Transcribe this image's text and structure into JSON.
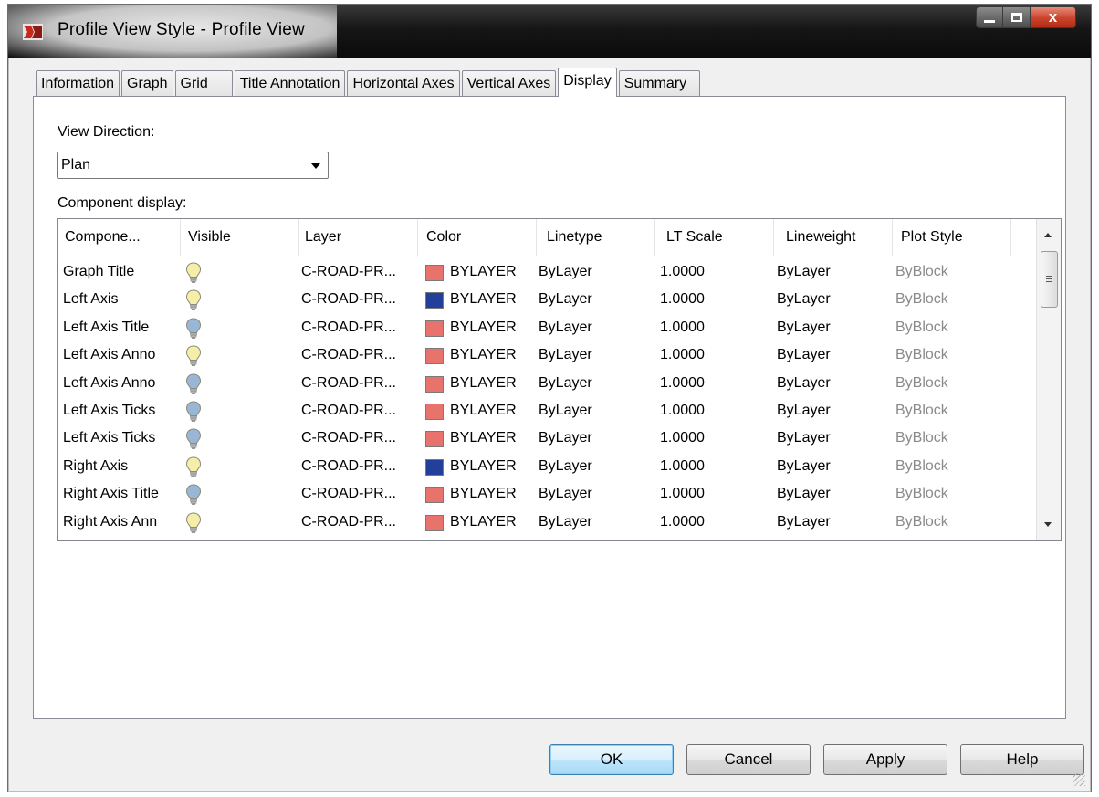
{
  "window": {
    "title": "Profile View Style - Profile View",
    "close_glyph": "x"
  },
  "tabs": [
    {
      "label": "Information",
      "active": false
    },
    {
      "label": "Graph",
      "active": false
    },
    {
      "label": "Grid",
      "active": false
    },
    {
      "label": "Title Annotation",
      "active": false
    },
    {
      "label": "Horizontal Axes",
      "active": false
    },
    {
      "label": "Vertical Axes",
      "active": false
    },
    {
      "label": "Display",
      "active": true
    },
    {
      "label": "Summary",
      "active": false
    }
  ],
  "display": {
    "view_direction_label": "View Direction:",
    "view_direction_value": "Plan",
    "component_display_label": "Component display:",
    "columns": [
      "Compone...",
      "Visible",
      "Layer",
      "Color",
      "Linetype",
      "LT Scale",
      "Lineweight",
      "Plot Style"
    ],
    "rows": [
      {
        "component": "Graph Title",
        "visible": "off",
        "layer": "C-ROAD-PR...",
        "color_swatch": "#e8736c",
        "color": "BYLAYER",
        "linetype": "ByLayer",
        "lt_scale": "1.0000",
        "lineweight": "ByLayer",
        "plot_style": "ByBlock"
      },
      {
        "component": "Left Axis",
        "visible": "off",
        "layer": "C-ROAD-PR...",
        "color_swatch": "#22409a",
        "color": "BYLAYER",
        "linetype": "ByLayer",
        "lt_scale": "1.0000",
        "lineweight": "ByLayer",
        "plot_style": "ByBlock"
      },
      {
        "component": "Left Axis Title",
        "visible": "on",
        "layer": "C-ROAD-PR...",
        "color_swatch": "#e8736c",
        "color": "BYLAYER",
        "linetype": "ByLayer",
        "lt_scale": "1.0000",
        "lineweight": "ByLayer",
        "plot_style": "ByBlock"
      },
      {
        "component": "Left Axis Anno",
        "visible": "off",
        "layer": "C-ROAD-PR...",
        "color_swatch": "#e8736c",
        "color": "BYLAYER",
        "linetype": "ByLayer",
        "lt_scale": "1.0000",
        "lineweight": "ByLayer",
        "plot_style": "ByBlock"
      },
      {
        "component": "Left Axis Anno",
        "visible": "on",
        "layer": "C-ROAD-PR...",
        "color_swatch": "#e8736c",
        "color": "BYLAYER",
        "linetype": "ByLayer",
        "lt_scale": "1.0000",
        "lineweight": "ByLayer",
        "plot_style": "ByBlock"
      },
      {
        "component": "Left Axis Ticks",
        "visible": "on",
        "layer": "C-ROAD-PR...",
        "color_swatch": "#e8736c",
        "color": "BYLAYER",
        "linetype": "ByLayer",
        "lt_scale": "1.0000",
        "lineweight": "ByLayer",
        "plot_style": "ByBlock"
      },
      {
        "component": "Left Axis Ticks",
        "visible": "on",
        "layer": "C-ROAD-PR...",
        "color_swatch": "#e8736c",
        "color": "BYLAYER",
        "linetype": "ByLayer",
        "lt_scale": "1.0000",
        "lineweight": "ByLayer",
        "plot_style": "ByBlock"
      },
      {
        "component": "Right Axis",
        "visible": "off",
        "layer": "C-ROAD-PR...",
        "color_swatch": "#22409a",
        "color": "BYLAYER",
        "linetype": "ByLayer",
        "lt_scale": "1.0000",
        "lineweight": "ByLayer",
        "plot_style": "ByBlock"
      },
      {
        "component": "Right Axis Title",
        "visible": "on",
        "layer": "C-ROAD-PR...",
        "color_swatch": "#e8736c",
        "color": "BYLAYER",
        "linetype": "ByLayer",
        "lt_scale": "1.0000",
        "lineweight": "ByLayer",
        "plot_style": "ByBlock"
      },
      {
        "component": "Right Axis Ann",
        "visible": "off",
        "layer": "C-ROAD-PR...",
        "color_swatch": "#e8736c",
        "color": "BYLAYER",
        "linetype": "ByLayer",
        "lt_scale": "1.0000",
        "lineweight": "ByLayer",
        "plot_style": "ByBlock"
      }
    ]
  },
  "buttons": {
    "ok": "OK",
    "cancel": "Cancel",
    "apply": "Apply",
    "help": "Help"
  },
  "icons": {
    "app": "civil-3d-app-icon",
    "visible_on": "lightbulb-on-icon",
    "visible_off": "lightbulb-off-icon"
  },
  "colors": {
    "bulb_on": "#f5eea8",
    "bulb_off": "#9ab6d6"
  }
}
